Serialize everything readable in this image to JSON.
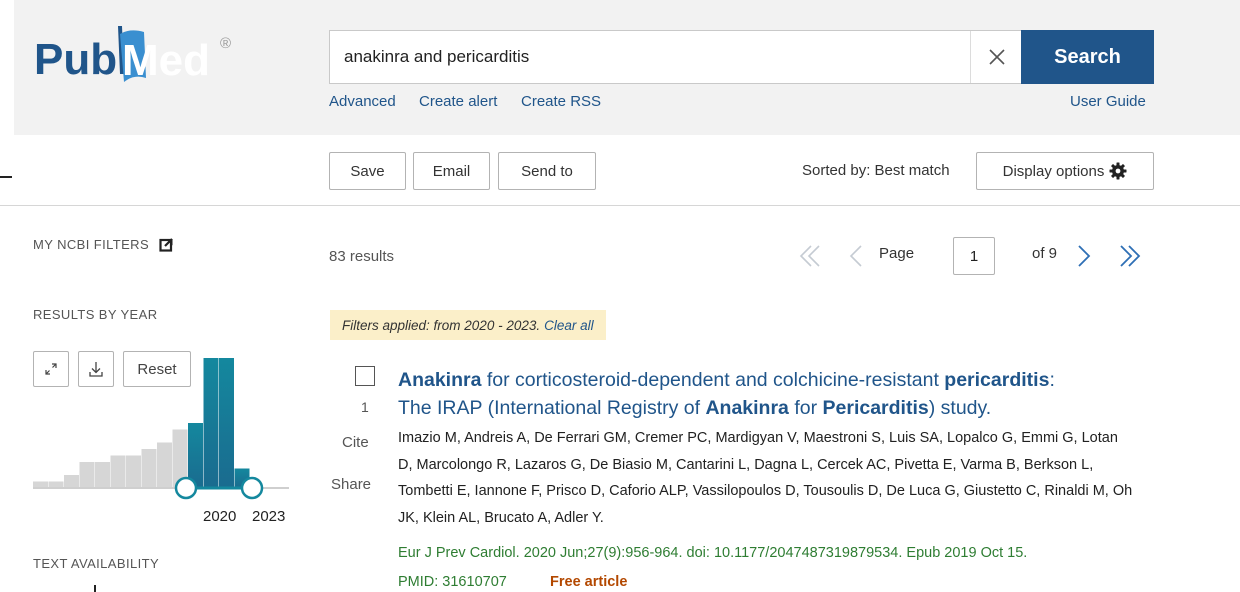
{
  "brand": {
    "logo_text_1": "Pub",
    "logo_text_2": "Med",
    "registered": "®",
    "colors": {
      "blue": "#20558a",
      "teal": "#14889e",
      "green": "#2e7d32"
    }
  },
  "search": {
    "query": "anakinra and pericarditis",
    "clear_icon": "close-icon",
    "button_label": "Search"
  },
  "search_links": {
    "advanced": "Advanced",
    "create_alert": "Create alert",
    "create_rss": "Create RSS",
    "user_guide": "User Guide"
  },
  "toolbar": {
    "save": "Save",
    "email": "Email",
    "send_to": "Send to",
    "sorted_by": "Sorted by: Best match",
    "display_options": "Display options",
    "display_icon": "gear-icon"
  },
  "sidebar": {
    "my_ncbi_filters": "MY NCBI FILTERS",
    "results_by_year": "RESULTS BY YEAR",
    "reset": "Reset",
    "year_start": "2020",
    "year_end": "2023",
    "text_availability": "TEXT AVAILABILITY"
  },
  "chart_data": {
    "type": "bar",
    "values": [
      1,
      1,
      2,
      4,
      4,
      5,
      5,
      6,
      7,
      9,
      10,
      20,
      20,
      3
    ],
    "highlighted_range": [
      10,
      13
    ],
    "colors": {
      "inactive": "#d6d6d6",
      "active_top": "#14889e",
      "active_bottom": "#1a6b8f"
    }
  },
  "results": {
    "count": "83 results",
    "page_label": "Page",
    "page_value": "1",
    "of_pages": "of 9",
    "filters_applied": "Filters applied: from 2020 - 2023.",
    "clear_all": "Clear all"
  },
  "article": {
    "number": "1",
    "cite": "Cite",
    "share": "Share",
    "title_line1": [
      {
        "text": "Anakinra",
        "bold": true
      },
      {
        "text": " for corticosteroid-dependent and colchicine-resistant ",
        "bold": false
      },
      {
        "text": "pericarditis",
        "bold": true
      },
      {
        "text": ":",
        "bold": false
      }
    ],
    "title_line2": [
      {
        "text": "The IRAP (International Registry of ",
        "bold": false
      },
      {
        "text": "Anakinra",
        "bold": true
      },
      {
        "text": " for ",
        "bold": false
      },
      {
        "text": "Pericarditis",
        "bold": true
      },
      {
        "text": ") study.",
        "bold": false
      }
    ],
    "authors": "Imazio M, Andreis A, De Ferrari GM, Cremer PC, Mardigyan V, Maestroni S, Luis SA, Lopalco G, Emmi G, Lotan D, Marcolongo R, Lazaros G, De Biasio M, Cantarini L, Dagna L, Cercek AC, Pivetta E, Varma B, Berkson L, Tombetti E, Iannone F, Prisco D, Caforio ALP, Vassilopoulos D, Tousoulis D, De Luca G, Giustetto C, Rinaldi M, Oh JK, Klein AL, Brucato A, Adler Y.",
    "citation": "Eur J Prev Cardiol. 2020 Jun;27(9):956-964. doi: 10.1177/2047487319879534. Epub 2019 Oct 15.",
    "pmid": "PMID: 31610707",
    "free_article": "Free article"
  }
}
